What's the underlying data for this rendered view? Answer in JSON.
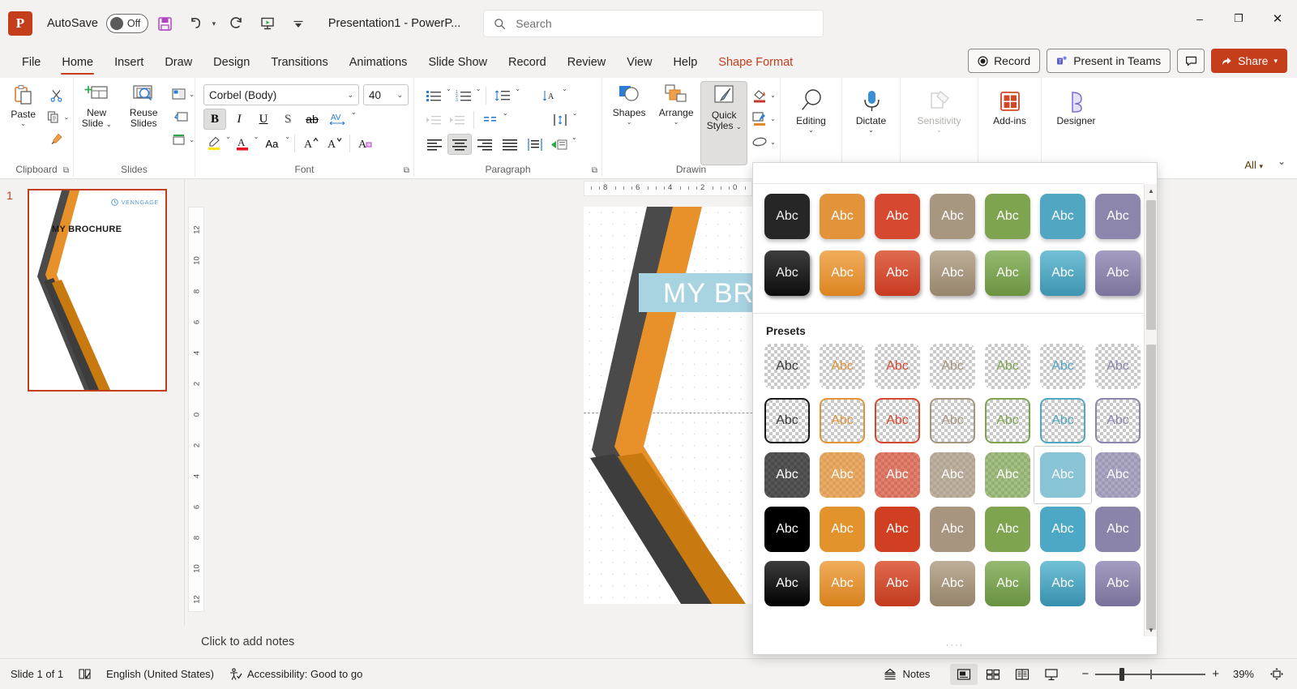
{
  "titlebar": {
    "app_icon": "powerpoint-logo",
    "app_letter": "P",
    "autosave_label": "AutoSave",
    "autosave_state": "Off",
    "save_icon": "save-icon",
    "undo_icon": "undo-icon",
    "redo_icon": "redo-icon",
    "start_presentation_icon": "start-presentation-icon",
    "customize_qat_icon": "customize-quick-access-toolbar-icon",
    "document_title": "Presentation1  -  PowerP...",
    "minimize": "–",
    "maximize": "❐",
    "close": "✕"
  },
  "search": {
    "placeholder": "Search",
    "icon": "search-icon"
  },
  "header_actions": {
    "record": "Record",
    "present_in_teams": "Present in Teams",
    "comments_icon": "comments-icon",
    "share": "Share"
  },
  "tabs": [
    {
      "label": "File",
      "active": false,
      "contextual": false
    },
    {
      "label": "Home",
      "active": true,
      "contextual": false
    },
    {
      "label": "Insert",
      "active": false,
      "contextual": false
    },
    {
      "label": "Draw",
      "active": false,
      "contextual": false
    },
    {
      "label": "Design",
      "active": false,
      "contextual": false
    },
    {
      "label": "Transitions",
      "active": false,
      "contextual": false
    },
    {
      "label": "Animations",
      "active": false,
      "contextual": false
    },
    {
      "label": "Slide Show",
      "active": false,
      "contextual": false
    },
    {
      "label": "Record",
      "active": false,
      "contextual": false
    },
    {
      "label": "Review",
      "active": false,
      "contextual": false
    },
    {
      "label": "View",
      "active": false,
      "contextual": false
    },
    {
      "label": "Help",
      "active": false,
      "contextual": false
    },
    {
      "label": "Shape Format",
      "active": false,
      "contextual": true
    }
  ],
  "ribbon": {
    "all_dropdown": "All",
    "collapse_icon": "collapse-ribbon-icon",
    "groups": {
      "clipboard": {
        "label": "Clipboard",
        "paste": "Paste",
        "cut_icon": "scissors-cut-icon",
        "copy_icon": "copy-icon",
        "format_painter_icon": "format-painter-icon"
      },
      "slides": {
        "label": "Slides",
        "new_slide": "New",
        "new_slide2": "Slide",
        "reuse": "Reuse",
        "reuse2": "Slides",
        "layout_icon": "slide-layout-icon",
        "reset_icon": "reset-slide-icon",
        "section_icon": "section-icon"
      },
      "font": {
        "label": "Font",
        "font_name": "Corbel (Body)",
        "font_size": "40",
        "bold": "B",
        "italic": "I",
        "underline": "U",
        "shadow": "S",
        "strikethrough": "ab",
        "char_spacing": "AV",
        "highlight_icon": "text-highlight-icon",
        "font_color_icon": "font-color-icon",
        "change_case": "Aa",
        "increase_size": "A",
        "decrease_size": "A",
        "clear_format_icon": "clear-formatting-icon"
      },
      "paragraph": {
        "label": "Paragraph",
        "bullets_icon": "bullets-icon",
        "numbering_icon": "numbering-icon",
        "line_spacing_icon": "line-spacing-icon",
        "text_direction_icon": "text-direction-icon",
        "decrease_indent_icon": "decrease-indent-icon",
        "increase_indent_icon": "increase-indent-icon",
        "columns_icon": "columns-icon",
        "align_text_icon": "align-text-vertical-icon",
        "align_left_icon": "align-left-icon",
        "align_center_icon": "align-center-icon",
        "align_right_icon": "align-right-icon",
        "justify_icon": "justify-icon",
        "distribute_icon": "distribute-text-icon",
        "smartart_icon": "convert-to-smartart-icon"
      },
      "drawing": {
        "label": "Drawin",
        "shapes": "Shapes",
        "arrange": "Arrange",
        "quick_styles": "Quick",
        "quick_styles2": "Styles",
        "shape_fill_icon": "shape-fill-icon",
        "shape_outline_icon": "shape-outline-icon",
        "shape_effects_icon": "shape-effects-icon"
      },
      "editing": {
        "label": "Editing",
        "editing": "Editing",
        "icon": "magnifier-icon"
      },
      "dictate": {
        "dictate": "Dictate",
        "icon": "microphone-icon"
      },
      "sensitivity": {
        "sensitivity": "Sensitivity",
        "icon": "sensitivity-label-icon"
      },
      "addins": {
        "addins": "Add-ins",
        "icon": "add-ins-grid-icon"
      },
      "designer": {
        "designer": "Designer",
        "icon": "designer-icon"
      }
    }
  },
  "slide_panel": {
    "slide_number": "1",
    "thumbnail": {
      "watermark": "VENNGAGE",
      "watermark_icon": "venngage-logo-icon",
      "title": "MY BROCHURE"
    }
  },
  "canvas": {
    "h_ruler_ticks": [
      "8",
      "6",
      "4",
      "2",
      "0"
    ],
    "v_ruler_ticks": [
      "12",
      "10",
      "8",
      "6",
      "4",
      "2",
      "0",
      "2",
      "4",
      "6",
      "8",
      "10",
      "12"
    ],
    "selected_text": "MY BROC",
    "highlight_color": "#a8d3e0",
    "notes_placeholder": "Click to add notes"
  },
  "quick_styles": {
    "presets_label": "Presets",
    "sample_text": "Abc",
    "palette": [
      "#262626",
      "#e3933a",
      "#d6482f",
      "#a89780",
      "#7ea44f",
      "#51a6c2",
      "#8c85ac"
    ],
    "palette_light": [
      "#7a7a7a",
      "#f3b983",
      "#e7928a",
      "#c4b8a3",
      "#adc98e",
      "#9ed0e0",
      "#b8b3cc"
    ],
    "theme_rows": [
      {
        "style": "light-fill",
        "clipped": true
      },
      {
        "style": "solid-fill-shadow"
      },
      {
        "style": "gradient-fill-shadow"
      }
    ],
    "preset_rows": [
      {
        "style": "transparent-colored-text"
      },
      {
        "style": "transparent-colored-outline"
      },
      {
        "style": "semi-transparent-fill",
        "selected_index": 5
      },
      {
        "style": "solid-fill"
      },
      {
        "style": "gradient-fill"
      }
    ],
    "scroll_up_icon": "scroll-up-arrow-icon",
    "scroll_down_icon": "scroll-down-arrow-icon",
    "resize_grip_icon": "resize-grip-icon"
  },
  "statusbar": {
    "slide_count": "Slide 1 of 1",
    "spellcheck_icon": "spellcheck-icon",
    "language": "English (United States)",
    "accessibility_icon": "accessibility-icon",
    "accessibility": "Accessibility: Good to go",
    "notes": "Notes",
    "notes_icon": "notes-icon",
    "view_normal_icon": "normal-view-icon",
    "view_sorter_icon": "slide-sorter-icon",
    "view_reading_icon": "reading-view-icon",
    "view_slideshow_icon": "slide-show-icon",
    "zoom_out": "−",
    "zoom_in": "+",
    "zoom_level": "39%",
    "fit_slide_icon": "fit-slide-to-window-icon"
  }
}
